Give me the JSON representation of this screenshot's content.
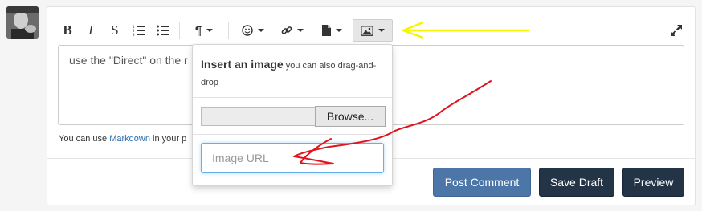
{
  "editor": {
    "textarea_text": "use the \"Direct\" on the r",
    "help_prefix": "You can use",
    "help_link": "Markdown",
    "help_suffix": "in your p"
  },
  "toolbar": {
    "icons": [
      "bold-icon",
      "italic-icon",
      "strikethrough-icon",
      "ordered-list-icon",
      "unordered-list-icon",
      "paragraph-icon",
      "emoji-icon",
      "link-icon",
      "file-icon",
      "image-icon",
      "expand-icon"
    ]
  },
  "image_dropdown": {
    "title": "Insert an image",
    "subtitle": "you can also drag-and-drop",
    "browse_label": "Browse...",
    "url_placeholder": "Image URL"
  },
  "actions": {
    "post_label": "Post Comment",
    "draft_label": "Save Draft",
    "preview_label": "Preview"
  },
  "colors": {
    "post_button": "#4c76a8",
    "dark_button": "#243447",
    "annotation_arrow_yellow": "#f5f500",
    "annotation_arrow_red": "#e0141e"
  }
}
